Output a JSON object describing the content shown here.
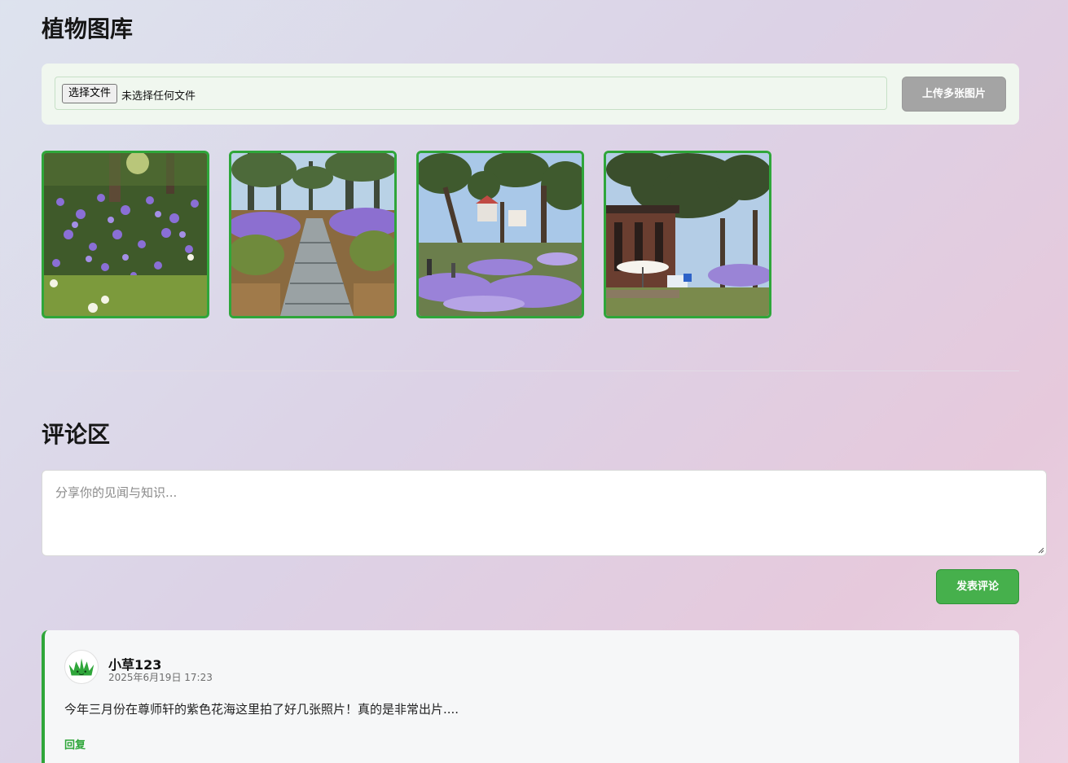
{
  "gallery": {
    "title": "植物图库",
    "file_button_label": "选择文件",
    "file_status": "未选择任何文件",
    "upload_button_label": "上传多张图片",
    "images": [
      {
        "alt": "purple-flowers-closeup"
      },
      {
        "alt": "stone-path-flowers"
      },
      {
        "alt": "trees-flower-field"
      },
      {
        "alt": "pavilion-umbrella-garden"
      }
    ]
  },
  "comments": {
    "title": "评论区",
    "input_placeholder": "分享你的见闻与知识...",
    "post_button_label": "发表评论",
    "items": [
      {
        "user": "小草123",
        "time": "2025年6月19日 17:23",
        "text": "今年三月份在尊师轩的紫色花海这里拍了好几张照片！真的是非常出片....",
        "reply_label": "回复",
        "avatar_icon": "grass-avatar-icon"
      }
    ]
  },
  "colors": {
    "accent_green": "#2fa63a",
    "button_green": "#46b04c",
    "disabled_gray": "#a4a4a4"
  }
}
